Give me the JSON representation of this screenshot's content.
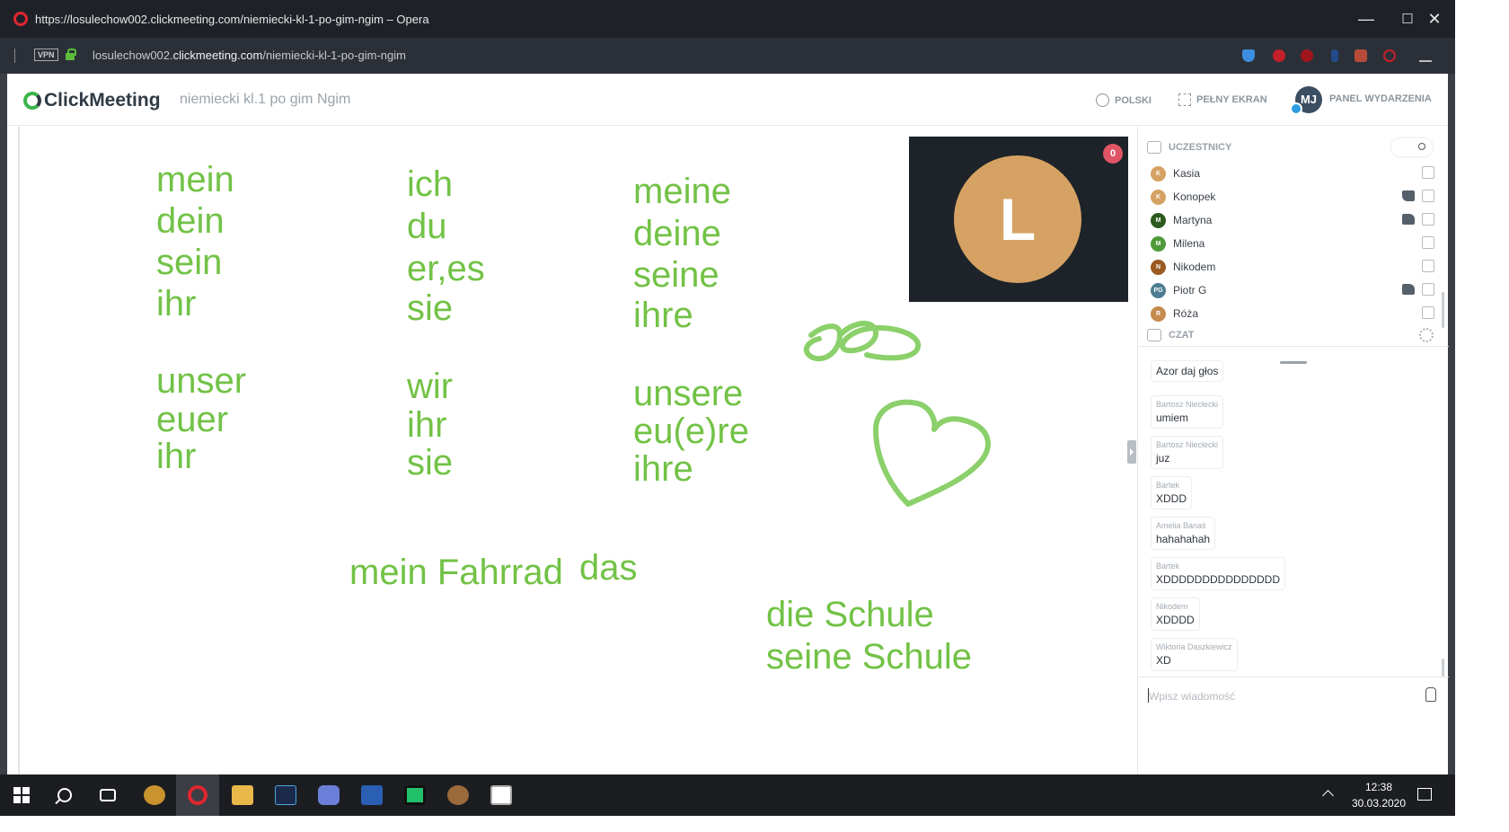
{
  "browser": {
    "window_title": "https://losulechow002.clickmeeting.com/niemiecki-kl-1-po-gim-ngim – Opera",
    "url_prefix": "losulechow002.",
    "url_host": "clickmeeting.com",
    "url_path": "/niemiecki-kl-1-po-gim-ngim",
    "vpn_label": "VPN",
    "minimize": "—",
    "maximize": "☐",
    "close": "✕"
  },
  "app": {
    "brand": "ClickMeeting",
    "event_title": "niemiecki kl.1 po gim Ngim",
    "language_btn": "POLSKI",
    "fullscreen_btn": "PEŁNY EKRAN",
    "user_initials": "MJ",
    "panel_btn": "PANEL WYDARZENIA"
  },
  "whiteboard": {
    "words": [
      {
        "text": "mein"
      },
      {
        "text": "dein"
      },
      {
        "text": "sein"
      },
      {
        "text": "ihr"
      },
      {
        "text": "unser"
      },
      {
        "text": "euer"
      },
      {
        "text": "ihr"
      },
      {
        "text": "ich"
      },
      {
        "text": "du"
      },
      {
        "text": "er,es"
      },
      {
        "text": "sie"
      },
      {
        "text": "wir"
      },
      {
        "text": "ihr"
      },
      {
        "text": "sie"
      },
      {
        "text": "meine"
      },
      {
        "text": "deine"
      },
      {
        "text": "seine"
      },
      {
        "text": "ihre"
      },
      {
        "text": "unsere"
      },
      {
        "text": "eu(e)re"
      },
      {
        "text": "ihre"
      },
      {
        "text": "mein Fahrrad"
      },
      {
        "text": "das"
      },
      {
        "text": "die Schule"
      },
      {
        "text": "seine Schule"
      }
    ],
    "ink_color": "#72c246",
    "webcam": {
      "initial": "L",
      "badge": "0",
      "avatar_color": "#d6a263"
    }
  },
  "participants": {
    "title": "UCZESTNICY",
    "list": [
      {
        "initial": "K",
        "name": "Kasia",
        "color": "#d6a263"
      },
      {
        "initial": "K",
        "name": "Konopek",
        "color": "#d6a263"
      },
      {
        "initial": "M",
        "name": "Martyna",
        "color": "#2d5a1e"
      },
      {
        "initial": "M",
        "name": "Milena",
        "color": "#4f9a3a"
      },
      {
        "initial": "N",
        "name": "Nikodem",
        "color": "#9a5a22"
      },
      {
        "initial": "PG",
        "name": "Piotr G",
        "color": "#4e7c91"
      },
      {
        "initial": "R",
        "name": "Róża",
        "color": "#c58a4e"
      }
    ]
  },
  "chat": {
    "title": "CZAT",
    "messages": [
      {
        "author": "",
        "text": "Azor daj głos"
      },
      {
        "author": "Bartosz Niecłecki",
        "text": "umiem"
      },
      {
        "author": "Bartosz Niecłecki",
        "text": "juz"
      },
      {
        "author": "Bartek",
        "text": "XDDD"
      },
      {
        "author": "Amelia Banaś",
        "text": "hahahahah"
      },
      {
        "author": "Bartek",
        "text": "XDDDDDDDDDDDDDDD"
      },
      {
        "author": "Nikodem",
        "text": "XDDDD"
      },
      {
        "author": "Wiktoria Daszkiewicz",
        "text": "XD"
      }
    ],
    "input_placeholder": "Wpisz wiadomość"
  },
  "taskbar": {
    "time": "12:38",
    "date": "30.03.2020"
  }
}
